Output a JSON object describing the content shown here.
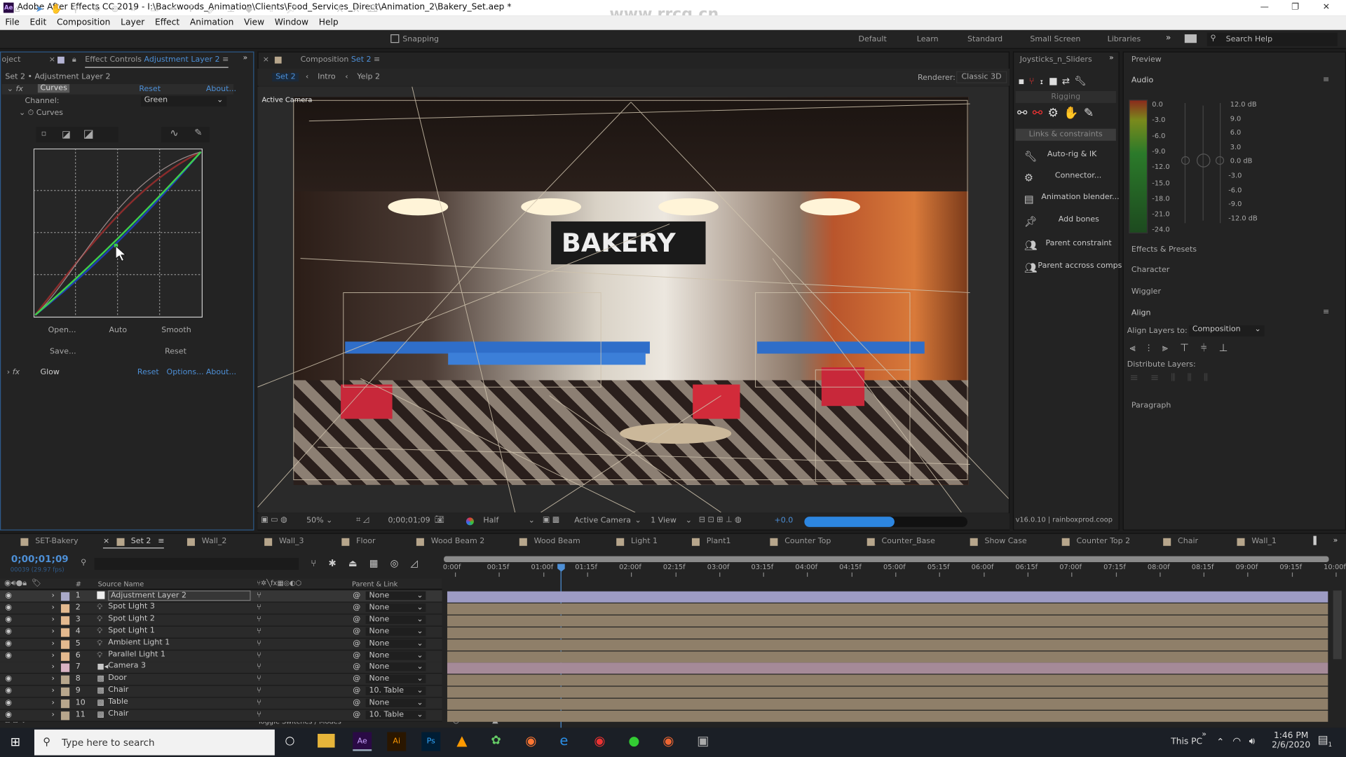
{
  "window": {
    "title": "Adobe After Effects CC 2019 - I:\\Backwoods_Animation\\Clients\\Food_Services_Direct\\Animation_2\\Bakery_Set.aep *",
    "app_icon": "Ae",
    "watermark": "www.rrcg.cn"
  },
  "menu": [
    "File",
    "Edit",
    "Composition",
    "Layer",
    "Effect",
    "Animation",
    "View",
    "Window",
    "Help"
  ],
  "toolbar": {
    "snapping": "Snapping",
    "workspaces": [
      "Default",
      "Learn",
      "Standard",
      "Small Screen",
      "Libraries"
    ],
    "search_help": "Search Help"
  },
  "effect_controls": {
    "project_tab": "oject",
    "tab_prefix": "Effect Controls",
    "tab_layer": "Adjustment Layer 2",
    "breadcrumb": "Set 2 • Adjustment Layer 2",
    "curves": {
      "name": "Curves",
      "reset": "Reset",
      "about": "About...",
      "channel_label": "Channel:",
      "channel_value": "Green",
      "curves_label": "Curves",
      "open": "Open...",
      "auto": "Auto",
      "smooth": "Smooth",
      "save": "Save...",
      "reset2": "Reset"
    },
    "glow": {
      "name": "Glow",
      "reset": "Reset",
      "options": "Options...",
      "about": "About..."
    }
  },
  "composition": {
    "tab_prefix": "Composition",
    "tab_name": "Set 2",
    "nav": [
      "Set 2",
      "Intro",
      "Yelp 2"
    ],
    "renderer_label": "Renderer:",
    "renderer_value": "Classic 3D",
    "active_camera_label": "Active Camera",
    "sign_text": "BAKERY",
    "footer": {
      "zoom": "50%",
      "timecode": "0;00;01;09",
      "resolution": "Half",
      "view": "Active Camera",
      "views": "1 View",
      "exposure": "+0.0"
    }
  },
  "joysticks": {
    "title": "Joysticks_n_Sliders",
    "rigging": "Rigging",
    "links": "Links & constraints",
    "items": [
      "Auto-rig & IK",
      "Connector...",
      "Animation blender...",
      "Add bones",
      "Parent constraint",
      "Parent accross comps"
    ],
    "version": "v16.0.10 | rainboxprod.coop",
    "progress_percent": 55
  },
  "right_panels": {
    "preview": "Preview",
    "audio": "Audio",
    "meter_labels": [
      "0.0",
      "-3.0",
      "-6.0",
      "-9.0",
      "-12.0",
      "-15.0",
      "-18.0",
      "-21.0",
      "-24.0"
    ],
    "gain_labels": [
      "12.0 dB",
      "9.0",
      "6.0",
      "3.0",
      "0.0 dB",
      "-3.0",
      "-6.0",
      "-9.0",
      "-12.0 dB"
    ],
    "effects_presets": "Effects & Presets",
    "character": "Character",
    "wiggler": "Wiggler",
    "align": "Align",
    "align_layers_to": "Align Layers to:",
    "align_target": "Composition",
    "distribute": "Distribute Layers:",
    "paragraph": "Paragraph"
  },
  "timeline": {
    "tabs": [
      "SET-Bakery",
      "Set 2",
      "Wall_2",
      "Wall_3",
      "Floor",
      "Wood Beam 2",
      "Wood Beam",
      "Light 1",
      "Plant1",
      "Counter Top",
      "Counter_Base",
      "Show Case",
      "Counter Top 2",
      "Chair",
      "Wall_1"
    ],
    "active_tab": "Set 2",
    "timecode": "0;00;01;09",
    "frame_info": "00039 (29.97 fps)",
    "col_source": "Source Name",
    "col_num": "#",
    "col_parent": "Parent & Link",
    "ruler": [
      "0:00f",
      "00:15f",
      "01:00f",
      "01:15f",
      "02:00f",
      "02:15f",
      "03:00f",
      "03:15f",
      "04:00f",
      "04:15f",
      "05:00f",
      "05:15f",
      "06:00f",
      "06:15f",
      "07:00f",
      "07:15f",
      "08:00f",
      "08:15f",
      "09:00f",
      "09:15f",
      "10:00f"
    ],
    "playhead_seconds": 1.3,
    "layers": [
      {
        "num": "1",
        "name": "Adjustment Layer 2",
        "parent": "None",
        "color": "#a9a9c9",
        "type": "adjustment",
        "eye": true
      },
      {
        "num": "2",
        "name": "Spot Light 3",
        "parent": "None",
        "color": "#e3b98f",
        "type": "light",
        "eye": true
      },
      {
        "num": "3",
        "name": "Spot Light 2",
        "parent": "None",
        "color": "#e3b98f",
        "type": "light",
        "eye": true
      },
      {
        "num": "4",
        "name": "Spot Light 1",
        "parent": "None",
        "color": "#e3b98f",
        "type": "light",
        "eye": true
      },
      {
        "num": "5",
        "name": "Ambient Light 1",
        "parent": "None",
        "color": "#e3b98f",
        "type": "light",
        "eye": true
      },
      {
        "num": "6",
        "name": "Parallel Light 1",
        "parent": "None",
        "color": "#e3b98f",
        "type": "light",
        "eye": true
      },
      {
        "num": "7",
        "name": "Camera 3",
        "parent": "None",
        "color": "#d9b3c3",
        "type": "camera",
        "eye": false
      },
      {
        "num": "8",
        "name": "Door",
        "parent": "None",
        "color": "#b7a68c",
        "type": "comp",
        "eye": true
      },
      {
        "num": "9",
        "name": "Chair",
        "parent": "10. Table",
        "color": "#b7a68c",
        "type": "comp",
        "eye": true
      },
      {
        "num": "10",
        "name": "Table",
        "parent": "None",
        "color": "#b7a68c",
        "type": "comp",
        "eye": true
      },
      {
        "num": "11",
        "name": "Chair",
        "parent": "10. Table",
        "color": "#b7a68c",
        "type": "comp",
        "eye": true
      }
    ],
    "toggle_label": "Toggle Switches / Modes"
  },
  "taskbar": {
    "search_placeholder": "Type here to search",
    "this_pc": "This PC",
    "time": "1:46 PM",
    "date": "2/6/2020",
    "notifications": "1"
  },
  "colors": {
    "accent": "#4d8fd6",
    "panel": "#232323",
    "curve_green": "#3fcf4a",
    "curve_red": "#b03535"
  }
}
